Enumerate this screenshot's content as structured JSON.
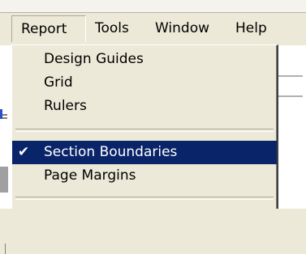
{
  "menubar": {
    "items": [
      {
        "label": "Report"
      },
      {
        "label": "Tools"
      },
      {
        "label": "Window"
      },
      {
        "label": "Help"
      }
    ]
  },
  "report_menu": {
    "items": [
      {
        "label": "Design Guides",
        "checked": false
      },
      {
        "label": "Grid",
        "checked": false
      },
      {
        "label": "Rulers",
        "checked": false
      },
      {
        "label": "Section Boundaries",
        "checked": true,
        "selected": true
      },
      {
        "label": "Page Margins",
        "checked": false
      }
    ],
    "check_glyph": "✔"
  },
  "colors": {
    "menu_background": "#ece9d8",
    "highlight_background": "#0a246a",
    "highlight_text": "#ffffff"
  }
}
